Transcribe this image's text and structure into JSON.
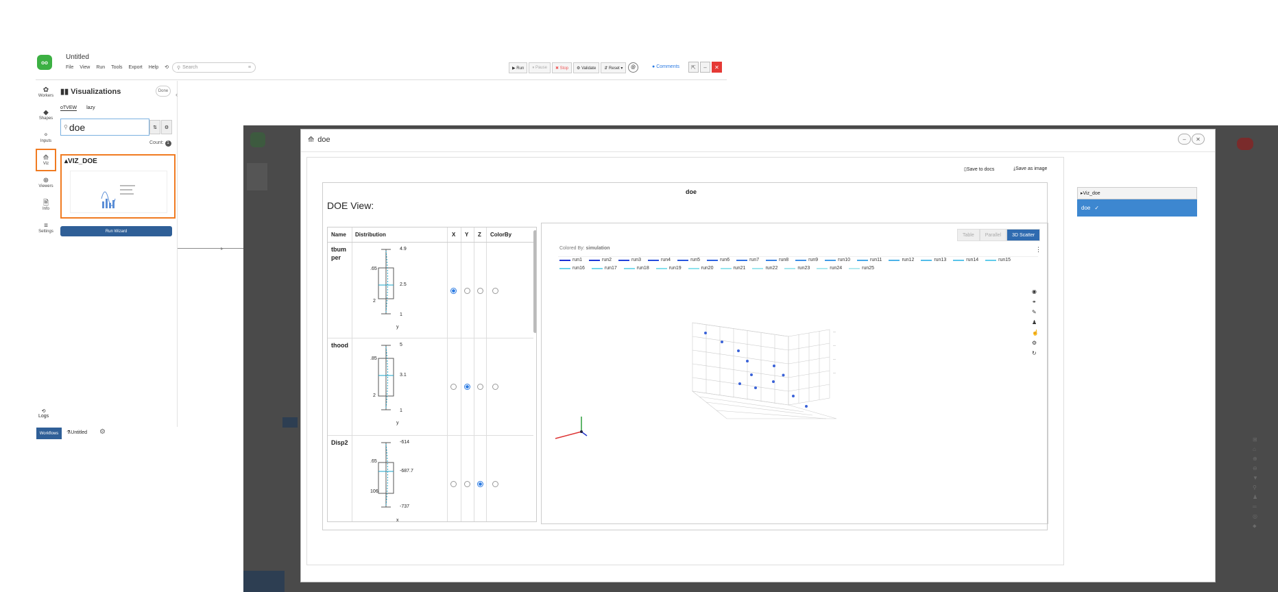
{
  "app": {
    "title": "Untitled",
    "logo_text": "oo",
    "menu": [
      "File",
      "View",
      "Run",
      "Tools",
      "Export",
      "Help"
    ],
    "search_placeholder": "Search",
    "toolbar": [
      "▶ Run",
      "⏸ Pause",
      "✖ Stop",
      "⚙ Validate",
      "⇵ Reset ▾"
    ],
    "comments": "Comments",
    "window_controls": [
      "⇱",
      "–",
      "✕"
    ]
  },
  "rail": [
    {
      "icon": "✿",
      "label": "Workers"
    },
    {
      "icon": "◆",
      "label": "Shapes"
    },
    {
      "icon": "⚬",
      "label": "Inputs"
    },
    {
      "icon": "⟰",
      "label": "Viz"
    },
    {
      "icon": "⊕",
      "label": "Viewers"
    },
    {
      "icon": "🗎",
      "label": "Info"
    },
    {
      "icon": "≡",
      "label": "Settings"
    }
  ],
  "panel": {
    "title": "Visualizations",
    "done": "Done",
    "tabs": [
      "oTVEW",
      "lazy"
    ],
    "search_value": "doe",
    "count_label": "Count:",
    "count_value": "1",
    "card_title": "VIZ_DOE",
    "run_button": "Run Wizard"
  },
  "logs": "Logs",
  "bottom": {
    "workflows": "Workflows",
    "untitled": "Untitled"
  },
  "modal": {
    "title": "doe",
    "ctrls": [
      "–",
      "✕"
    ],
    "save_docs": "Save to docs",
    "save_image": "Save as image",
    "panel_title": "doe",
    "doe_view": "DOE View:",
    "table": {
      "headers": [
        "Name",
        "Distribution",
        "X",
        "Y",
        "Z",
        "ColorBy"
      ],
      "rows": [
        {
          "name": "tbumper",
          "top": "4.9",
          "mid": "2.5",
          "bot": "1",
          "left_hi": ".65",
          "left_lo": "2",
          "axis": "y",
          "selected": "X"
        },
        {
          "name": "thood",
          "top": "5",
          "mid": "3.1",
          "bot": "1",
          "left_hi": ".85",
          "left_lo": "2",
          "axis": "y",
          "selected": "Y"
        },
        {
          "name": "Disp2",
          "top": "-614",
          "mid": "-687.7",
          "bot": "-737",
          "left_hi": ".65",
          "left_lo": "106",
          "axis": "x",
          "selected": "Z"
        }
      ]
    },
    "segments": [
      "Table",
      "Parallel",
      "3D Scatter"
    ],
    "colored_by_label": "Colored By:",
    "colored_by_value": "simulation",
    "legend": [
      "run1",
      "run2",
      "run3",
      "run4",
      "run5",
      "run6",
      "run7",
      "run8",
      "run9",
      "run10",
      "run11",
      "run12",
      "run13",
      "run14",
      "run15",
      "run16",
      "run17",
      "run18",
      "run19",
      "run20",
      "run21",
      "run22",
      "run23",
      "run24",
      "run25"
    ],
    "legend_colors": [
      "#1a2fd6",
      "#1c35d8",
      "#2040db",
      "#244bdd",
      "#2856df",
      "#2c61e1",
      "#3070e3",
      "#3680e4",
      "#3c8ee6",
      "#419be7",
      "#47a8e8",
      "#4cb2e9",
      "#52bcea",
      "#58c4ea",
      "#60cceb",
      "#69d2eb",
      "#72d7ec",
      "#7bdbec",
      "#84dfec",
      "#8de2ed",
      "#95e4ed",
      "#9de6ee",
      "#a4e7ee",
      "#abe8ef",
      "#b2e9ef"
    ],
    "list_header": "Viz_doe",
    "list_item": "doe"
  },
  "chart_data": {
    "type": "scatter",
    "title": "",
    "xlabel": "",
    "ylabel": "",
    "zlabel": "",
    "points": [
      {
        "x": 0.1,
        "y": 0.9,
        "z": 0.9
      },
      {
        "x": 0.2,
        "y": 0.85,
        "z": 0.7
      },
      {
        "x": 0.3,
        "y": 0.8,
        "z": 0.5
      },
      {
        "x": 0.5,
        "y": 0.6,
        "z": 0.8
      },
      {
        "x": 0.7,
        "y": 0.4,
        "z": 0.6
      },
      {
        "x": 0.8,
        "y": 0.3,
        "z": 0.3
      },
      {
        "x": 0.9,
        "y": 0.2,
        "z": 0.2
      },
      {
        "x": 0.4,
        "y": 0.5,
        "z": 0.4
      },
      {
        "x": 0.6,
        "y": 0.7,
        "z": 0.3
      },
      {
        "x": 0.35,
        "y": 0.3,
        "z": 0.6
      },
      {
        "x": 0.75,
        "y": 0.55,
        "z": 0.45
      },
      {
        "x": 0.55,
        "y": 0.25,
        "z": 0.7
      }
    ]
  }
}
